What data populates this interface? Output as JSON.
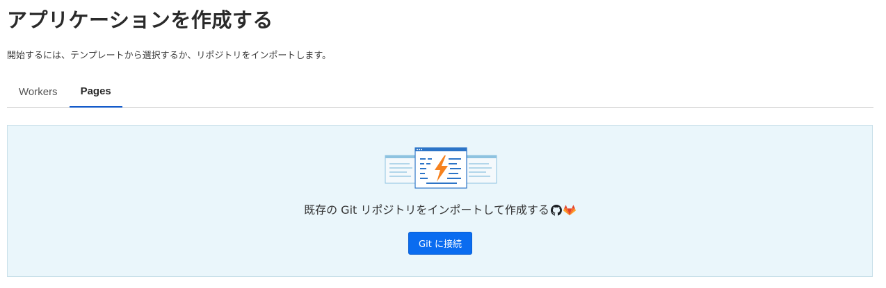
{
  "header": {
    "title": "アプリケーションを作成する",
    "subtitle": "開始するには、テンプレートから選択するか、リポジトリをインポートします。"
  },
  "tabs": [
    {
      "label": "Workers",
      "active": false
    },
    {
      "label": "Pages",
      "active": true
    }
  ],
  "panel": {
    "message": "既存の Git リポジトリをインポートして作成する",
    "button_label": "Git に接続",
    "icons": [
      "github-icon",
      "gitlab-icon"
    ]
  },
  "colors": {
    "accent": "#0a6cf0",
    "tab_underline": "#0b55c8",
    "panel_bg": "#eaf6fb",
    "bolt": "#f6821f"
  }
}
